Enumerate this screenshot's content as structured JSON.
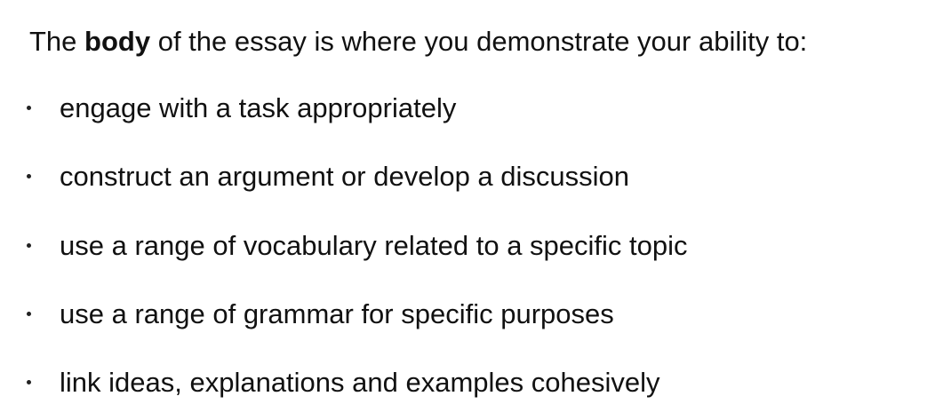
{
  "intro": {
    "before": "The ",
    "bold": "body",
    "after": " of the essay is where you demonstrate your ability to:"
  },
  "bullets": [
    "engage with a task appropriately",
    "construct an argument or develop a discussion",
    "use a range of vocabulary related to a specific topic",
    "use a range of grammar for specific purposes",
    "link ideas, explanations and examples cohesively"
  ]
}
